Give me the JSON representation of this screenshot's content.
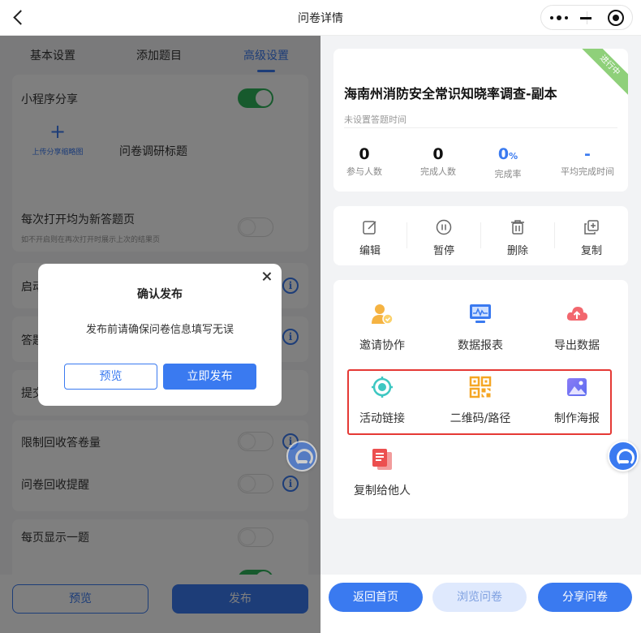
{
  "nav": {
    "title": "问卷详情"
  },
  "left": {
    "tabs": [
      "基本设置",
      "添加题目",
      "高级设置"
    ],
    "share": {
      "label": "小程序分享",
      "upload_label": "上传分享缩略图",
      "title_label": "问卷调研标题"
    },
    "new_page": {
      "label": "每次打开均为新答题页",
      "sub": "如不开启则在再次打开时展示上次的结果页"
    },
    "rows": {
      "start_partial": "启动",
      "answer_partial": "答题",
      "submit_partial": "提交",
      "limit": "限制回收答卷量",
      "reminder": "问卷回收提醒",
      "one_per_page": "每页显示一题"
    },
    "bottom": {
      "preview": "预览",
      "publish": "发布"
    }
  },
  "dialog": {
    "title": "确认发布",
    "message": "发布前请确保问卷信息填写无误",
    "preview": "预览",
    "publish_now": "立即发布"
  },
  "survey": {
    "title": "海南州消防安全常识知晓率调查-副本",
    "subtitle": "未设置答题时间",
    "status_badge": "进行中",
    "stats": [
      {
        "value": "0",
        "label": "参与人数"
      },
      {
        "value": "0",
        "label": "完成人数"
      },
      {
        "value": "0",
        "unit": "%",
        "label": "完成率"
      },
      {
        "value": "-",
        "label": "平均完成时间"
      }
    ]
  },
  "actions": {
    "edit": "编辑",
    "pause": "暂停",
    "delete": "删除",
    "copy": "复制"
  },
  "tools": {
    "invite": "邀请协作",
    "report": "数据报表",
    "export": "导出数据",
    "link": "活动链接",
    "qrcode": "二维码/路径",
    "poster": "制作海报",
    "copy_to_others": "复制给他人"
  },
  "right_bottom": {
    "home": "返回首页",
    "browse": "浏览问卷",
    "share": "分享问卷"
  },
  "colors": {
    "primary": "#3a7af0",
    "toggle_on": "#2fb45a",
    "badge": "#8fd07a",
    "highlight": "#e53935"
  }
}
